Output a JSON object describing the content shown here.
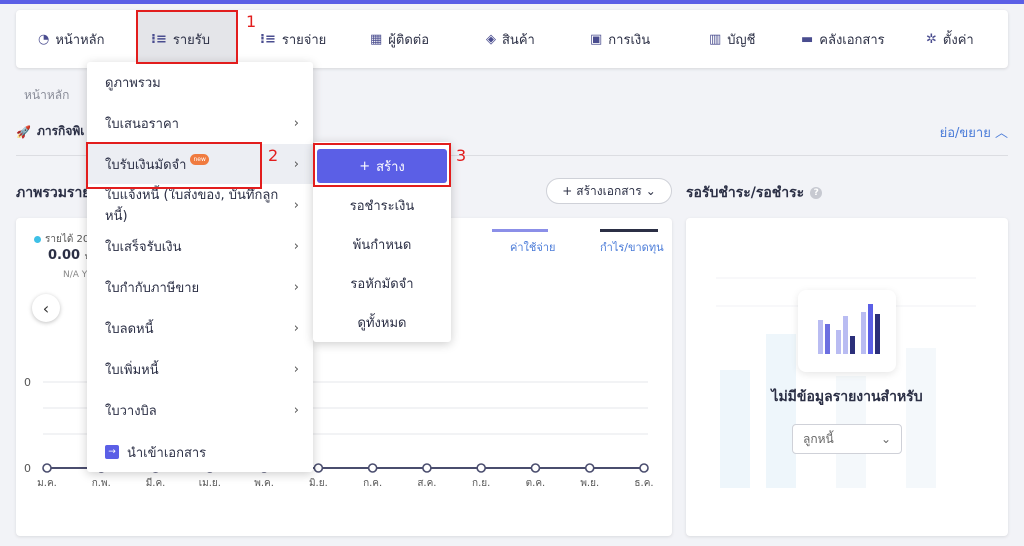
{
  "nav": {
    "items": [
      {
        "label": "หน้าหลัก",
        "icon": "dashboard-icon",
        "glyph": "◔"
      },
      {
        "label": "รายรับ",
        "icon": "income-list-icon",
        "glyph": "⁝≡"
      },
      {
        "label": "รายจ่าย",
        "icon": "expense-list-icon",
        "glyph": "⁝≡"
      },
      {
        "label": "ผู้ติดต่อ",
        "icon": "contacts-icon",
        "glyph": "▦"
      },
      {
        "label": "สินค้า",
        "icon": "product-box-icon",
        "glyph": "◈"
      },
      {
        "label": "การเงิน",
        "icon": "money-icon",
        "glyph": "▣"
      },
      {
        "label": "บัญชี",
        "icon": "accounting-book-icon",
        "glyph": "▥"
      },
      {
        "label": "คลังเอกสาร",
        "icon": "folder-icon",
        "glyph": "▬"
      },
      {
        "label": "ตั้งค่า",
        "icon": "gear-icon",
        "glyph": "✲"
      }
    ]
  },
  "annotations": {
    "one": "1",
    "two": "2",
    "three": "3"
  },
  "breadcrumb": "หน้าหลัก",
  "section": {
    "title": "ภารกิจพิเ",
    "collapse": "ย่อ/ขยาย"
  },
  "overview": {
    "title": "ภาพรวมราย",
    "create_doc": "สร้างเอกสาร"
  },
  "pending": {
    "title": "รอรับชำระ/รอชำระ"
  },
  "chart_left": {
    "income_legend": "รายได้ 20",
    "income_value": "0.00",
    "income_unit": "บ",
    "income_sub": "N/A Y",
    "legend_expense": "ค่าใช้จ่าย",
    "legend_profit": "กำไร/ขาดทุน",
    "expense_color": "#8b8fe8",
    "profit_color": "#2b2f45"
  },
  "chart_data": {
    "type": "line",
    "categories": [
      "ม.ค.",
      "ก.พ.",
      "มี.ค.",
      "เม.ย.",
      "พ.ค.",
      "มิ.ย.",
      "ก.ค.",
      "ส.ค.",
      "ก.ย.",
      "ต.ค.",
      "พ.ย.",
      "ธ.ค."
    ],
    "series": [
      {
        "values": [
          0,
          0,
          0,
          0,
          0,
          0,
          0,
          0,
          0,
          0,
          0,
          0
        ]
      }
    ],
    "yticks": [
      "0",
      "0"
    ],
    "grid": true
  },
  "empty": {
    "message": "ไม่มีข้อมูลรายงานสำหรับ",
    "select_value": "ลูกหนี้"
  },
  "dropdown": {
    "items": [
      {
        "label": "ดูภาพรวม",
        "arrow": false
      },
      {
        "label": "ใบเสนอราคา",
        "arrow": true
      },
      {
        "label": "ใบรับเงินมัดจำ",
        "arrow": true,
        "badge": "new"
      },
      {
        "label": "ใบแจ้งหนี้ (ใบส่งของ, บันทึกลูกหนี้)",
        "arrow": true
      },
      {
        "label": "ใบเสร็จรับเงิน",
        "arrow": true
      },
      {
        "label": "ใบกำกับภาษีขาย",
        "arrow": true
      },
      {
        "label": "ใบลดหนี้",
        "arrow": true
      },
      {
        "label": "ใบเพิ่มหนี้",
        "arrow": true
      },
      {
        "label": "ใบวางบิล",
        "arrow": true
      },
      {
        "label": "นำเข้าเอกสาร",
        "arrow": false
      }
    ]
  },
  "submenu": {
    "create": "สร้าง",
    "items": [
      "รอชำระเงิน",
      "พ้นกำหนด",
      "รอหักมัดจำ",
      "ดูทั้งหมด"
    ]
  }
}
